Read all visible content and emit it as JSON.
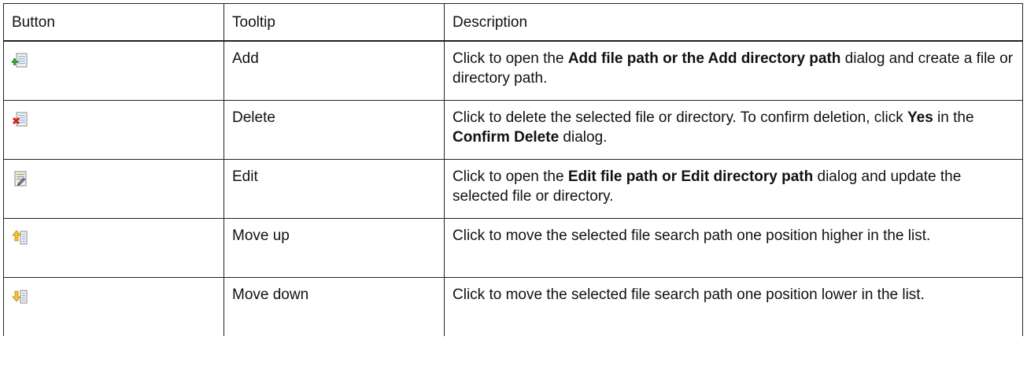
{
  "headers": {
    "button": "Button",
    "tooltip": "Tooltip",
    "description": "Description"
  },
  "rows": [
    {
      "icon": "add-file-icon",
      "tooltip": "Add",
      "desc": {
        "pre": "Click to open the ",
        "bold1": "Add file path or the Add directory path",
        "mid": " dialog and create a file or directory path.",
        "bold2": "",
        "post": ""
      }
    },
    {
      "icon": "delete-file-icon",
      "tooltip": "Delete",
      "desc": {
        "pre": "Click to delete the selected file or directory. To confirm deletion, click ",
        "bold1": "Yes",
        "mid": " in the ",
        "bold2": "Confirm Delete",
        "post": " dialog."
      }
    },
    {
      "icon": "edit-file-icon",
      "tooltip": "Edit",
      "desc": {
        "pre": "Click to open the ",
        "bold1": "Edit file path or Edit directory path",
        "mid": " dialog and update the selected file or directory.",
        "bold2": "",
        "post": ""
      }
    },
    {
      "icon": "move-up-icon",
      "tooltip": "Move up",
      "desc": {
        "pre": "Click to move the selected file search path one position higher in the list.",
        "bold1": "",
        "mid": "",
        "bold2": "",
        "post": ""
      }
    },
    {
      "icon": "move-down-icon",
      "tooltip": "Move down",
      "desc": {
        "pre": "Click to move the selected file search path one position lower in the list.",
        "bold1": "",
        "mid": "",
        "bold2": "",
        "post": ""
      }
    }
  ]
}
